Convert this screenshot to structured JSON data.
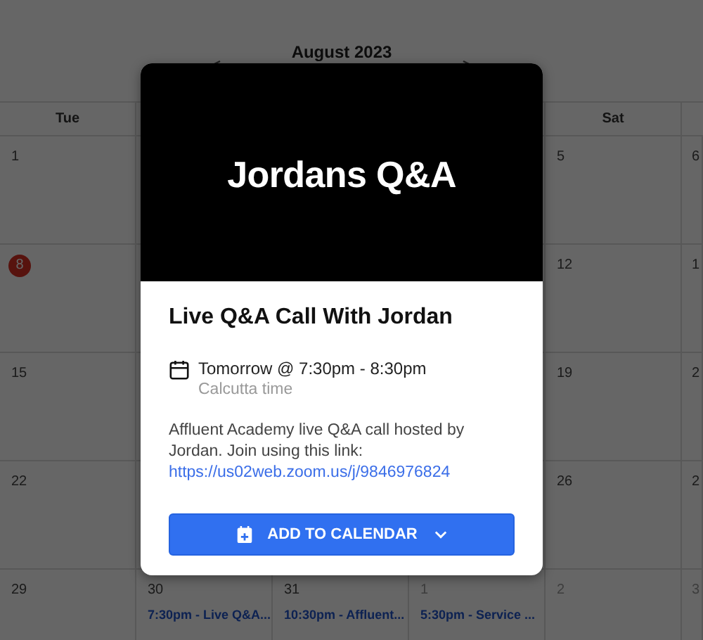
{
  "calendar": {
    "month": "August 2023",
    "weekdays": [
      {
        "label": "Tue"
      },
      {
        "label": "Sat"
      }
    ],
    "weeks": [
      {
        "cells": [
          {
            "day": "1",
            "today": false,
            "other_month": false
          },
          {},
          {},
          {},
          {
            "day": "5",
            "today": false,
            "other_month": false
          },
          {
            "day": "6",
            "today": false,
            "other_month": false
          }
        ]
      },
      {
        "cells": [
          {
            "day": "8",
            "today": true,
            "other_month": false
          },
          {},
          {},
          {},
          {
            "day": "12",
            "today": false,
            "other_month": false
          },
          {
            "day": "1",
            "today": false,
            "other_month": false
          }
        ]
      },
      {
        "cells": [
          {
            "day": "15",
            "today": false,
            "other_month": false
          },
          {},
          {},
          {},
          {
            "day": "19",
            "today": false,
            "other_month": false
          },
          {
            "day": "2",
            "today": false,
            "other_month": false
          }
        ]
      },
      {
        "cells": [
          {
            "day": "22",
            "today": false,
            "other_month": false
          },
          {},
          {},
          {},
          {
            "day": "26",
            "today": false,
            "other_month": false
          },
          {
            "day": "2",
            "today": false,
            "other_month": false
          }
        ]
      },
      {
        "cells": [
          {
            "day": "29",
            "today": false,
            "other_month": false
          },
          {
            "day": "30",
            "today": false,
            "other_month": false,
            "events": [
              "7:30pm - Live Q&A..."
            ]
          },
          {
            "day": "31",
            "today": false,
            "other_month": false,
            "events": [
              "10:30pm - Affluent..."
            ]
          },
          {
            "day": "1",
            "today": false,
            "other_month": true,
            "events": [
              "5:30pm - Service ..."
            ]
          },
          {
            "day": "2",
            "today": false,
            "other_month": true
          },
          {
            "day": "3",
            "today": false,
            "other_month": true
          }
        ]
      }
    ]
  },
  "event_modal": {
    "banner": "Jordans Q&A",
    "title": "Live Q&A Call With Jordan",
    "time": "Tomorrow @ 7:30pm - 8:30pm",
    "timezone": "Calcutta time",
    "description": "Affluent Academy live Q&A call hosted by Jordan. Join using this link:",
    "link": "https://us02web.zoom.us/j/9846976824",
    "button": "ADD TO CALENDAR"
  }
}
